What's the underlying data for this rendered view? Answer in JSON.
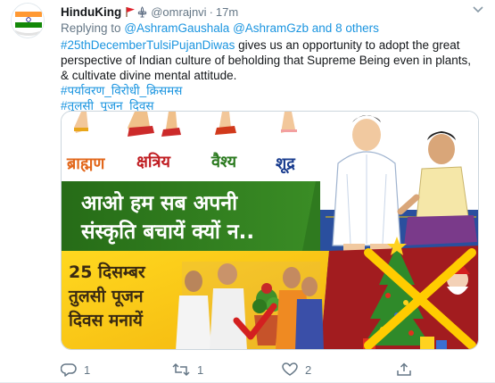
{
  "tweet": {
    "display_name": "HinduKing",
    "handle": "@omrajnvi",
    "separator": "·",
    "time": "17m",
    "replying_prefix": "Replying to",
    "replying_users": "@AshramGaushala @AshramGzb and 8 others",
    "hashtag_main": "#25thDecemberTulsiPujanDiwas",
    "body_text": " gives us an opportunity to adopt the great perspective of Indian culture of beholding that Supreme Being even in plants, & cultivate divine mental attitude.",
    "hashtag_2": "#पर्यावरण_विरोधी_क्रिसमस",
    "hashtag_3": "#तुलसी_पूजन_दिवस"
  },
  "poster": {
    "castes": [
      "ब्राह्मण",
      "क्षत्रिय",
      "वैश्य",
      "शूद्र"
    ],
    "headline_line1": "आओ हम सब अपनी",
    "headline_line2": "संस्कृति बचायें क्यों न..",
    "date_line1": "25 दिसम्बर",
    "date_line2": "तुलसी पूजन",
    "date_line3": "दिवस मनायें"
  },
  "actions": {
    "reply_count": "1",
    "retweet_count": "1",
    "like_count": "2"
  },
  "colors": {
    "link": "#1b95e0",
    "muted": "#657786",
    "poster_green": "#2f7a1f",
    "poster_yellow": "#ffd21f",
    "poster_red": "#b51f1f"
  }
}
